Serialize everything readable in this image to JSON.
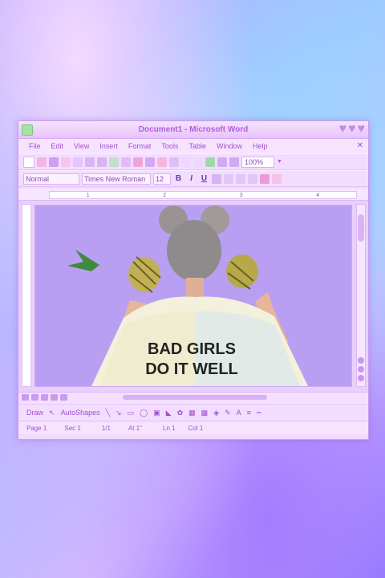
{
  "window": {
    "title": "Document1 - Microsoft Word"
  },
  "menu": [
    "File",
    "Edit",
    "View",
    "Insert",
    "Format",
    "Tools",
    "Table",
    "Window",
    "Help"
  ],
  "toolbar": {
    "zoom": "100%"
  },
  "format": {
    "style": "Normal",
    "font": "Times New Roman",
    "size": "12",
    "bold": "B",
    "italic": "I",
    "underline": "U"
  },
  "ruler": {
    "marks": [
      "1",
      "2",
      "3",
      "4"
    ]
  },
  "document": {
    "shirt_line1": "BAD GIRLS",
    "shirt_line2": "DO IT WELL"
  },
  "drawbar": {
    "draw": "Draw",
    "autoshapes": "AutoShapes"
  },
  "status": {
    "page": "Page 1",
    "sec": "Sec 1",
    "pages": "1/1",
    "at": "At 1\"",
    "ln": "Ln 1",
    "col": "Col 1"
  },
  "colors": {
    "accent": "#b060d8",
    "page": "#b99ff1"
  }
}
